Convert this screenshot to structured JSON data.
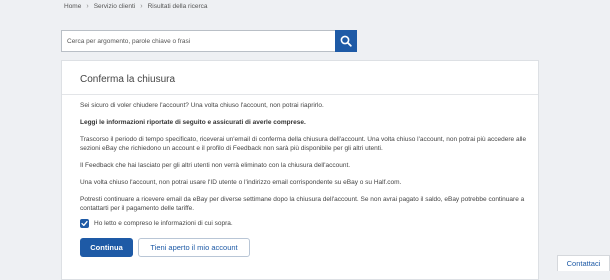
{
  "breadcrumb": {
    "items": [
      "Home",
      "Servizio clienti",
      "Risultati della ricerca"
    ]
  },
  "search": {
    "placeholder": "Cerca per argomento, parole chiave o frasi",
    "icon": "search-icon"
  },
  "panel": {
    "title": "Conferma la chiusura",
    "paragraphs": [
      "Sei sicuro di voler chiudere l'account? Una volta chiuso l'account, non potrai riaprirlo.",
      "Leggi le informazioni riportate di seguito e assicurati di averle comprese.",
      "Trascorso il periodo di tempo specificato, riceverai un'email di conferma della chiusura dell'account. Una volta chiuso l'account, non potrai più accedere alle sezioni eBay che richiedono un account e il profilo di Feedback non sarà più disponibile per gli altri utenti.",
      "Il Feedback che hai lasciato per gli altri utenti non verrà eliminato con la chiusura dell'account.",
      "Una volta chiuso l'account, non potrai usare l'ID utente o l'indirizzo email corrispondente su eBay o su Half.com.",
      "Potresti continuare a ricevere email da eBay per diverse settimane dopo la chiusura dell'account. Se non avrai pagato il saldo, eBay potrebbe continuare a contattarti per il pagamento delle tariffe."
    ],
    "checkbox_label": "Ho letto e compreso le informazioni di cui sopra.",
    "checkbox_checked": true,
    "continue_label": "Continua",
    "keep_open_label": "Tieni aperto il mio account"
  },
  "contact_tab": "Contattaci",
  "colors": {
    "accent": "#1e5aa6",
    "background": "#eef0f3"
  }
}
